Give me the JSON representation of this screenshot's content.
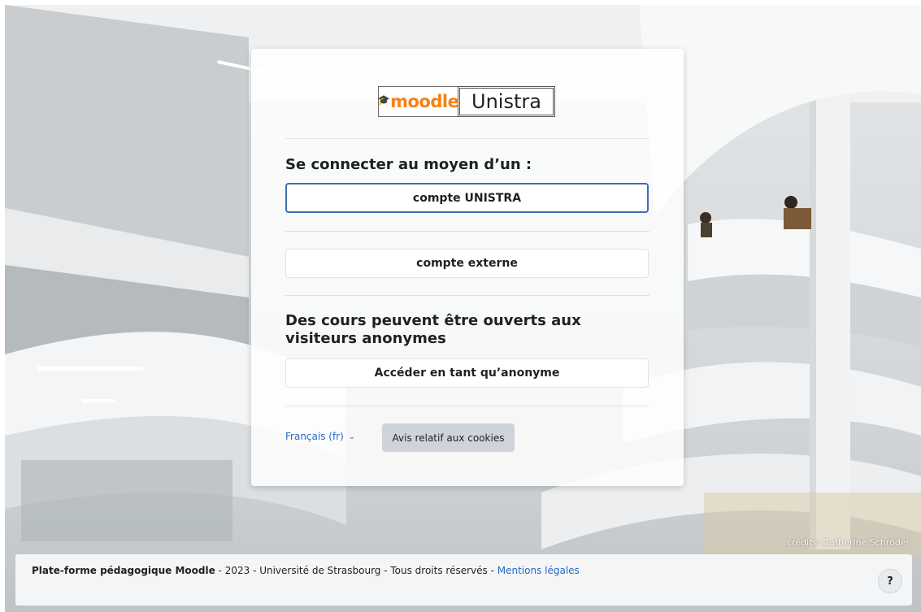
{
  "background": {
    "credit": "crédits: Catherine Schröder"
  },
  "logo": {
    "moodle_text": "moodle",
    "unistra_text": "Unistra"
  },
  "login": {
    "connect_title": "Se connecter au moyen d’un :",
    "unistra_button": "compte UNISTRA",
    "external_button": "compte externe",
    "anon_title": "Des cours peuvent être ouverts aux visiteurs anonymes",
    "anon_button": "Accéder en tant qu’anonyme"
  },
  "card_footer": {
    "language": "Français (fr)",
    "cookies_button": "Avis relatif aux cookies"
  },
  "footer": {
    "platform": "Plate-forme pédagogique Moodle",
    "rest": " - 2023 - Université de Strasbourg - Tous droits réservés - ",
    "legal_link": "Mentions légales",
    "help_label": "?"
  },
  "colors": {
    "accent_link": "#2568c9",
    "moodle_orange": "#f98012",
    "focus_border": "#3b6fb0"
  }
}
